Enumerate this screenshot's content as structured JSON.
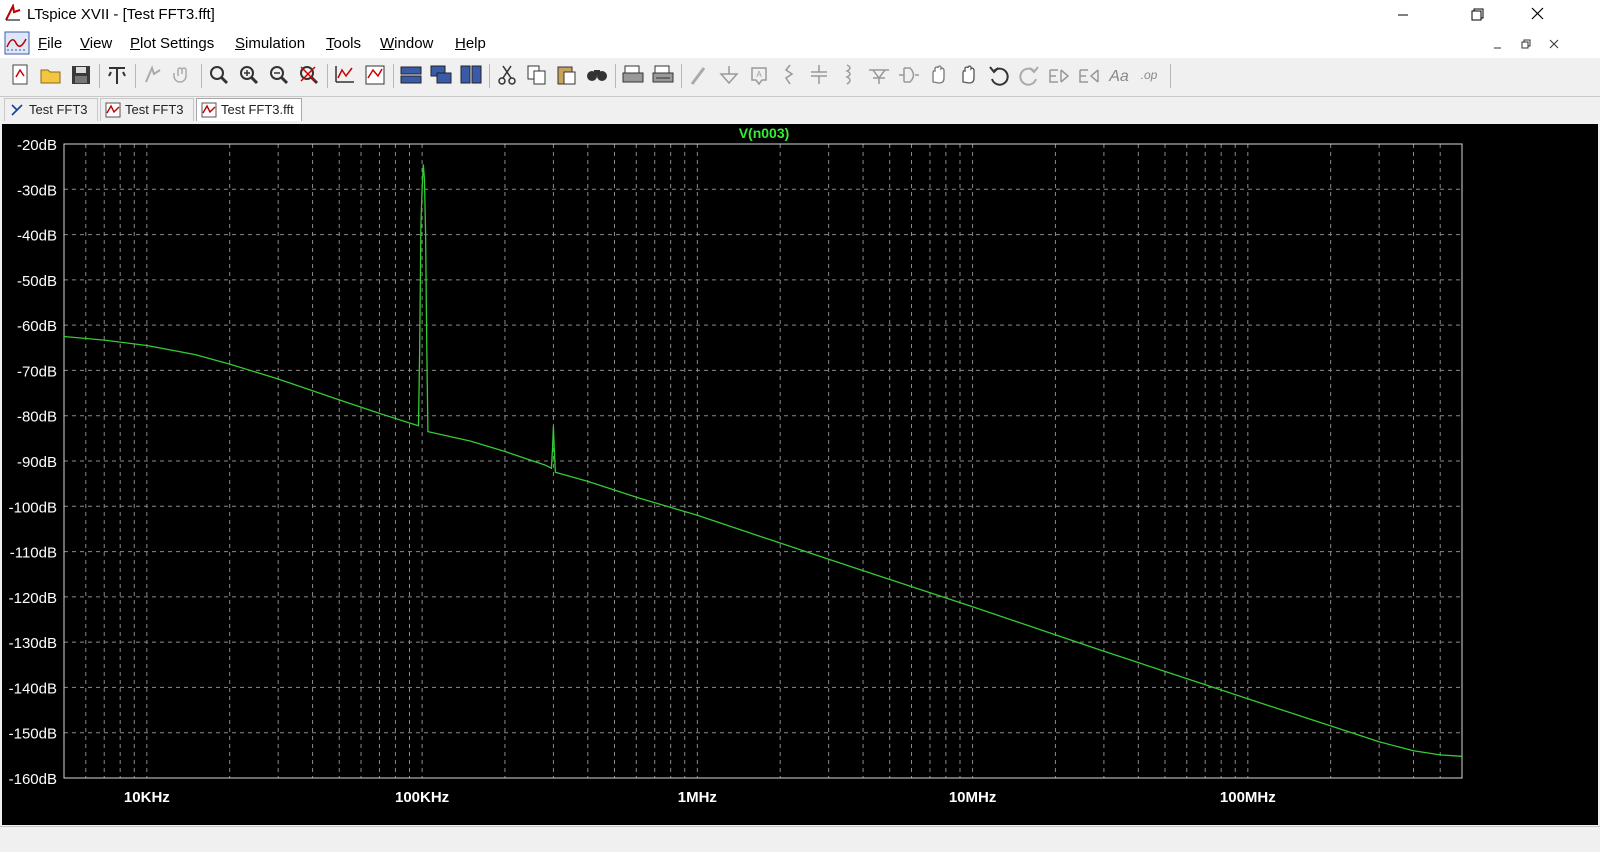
{
  "window": {
    "title": "LTspice XVII - [Test FFT3.fft]"
  },
  "menu": [
    {
      "label": "File"
    },
    {
      "label": "View"
    },
    {
      "label": "Plot Settings"
    },
    {
      "label": "Simulation"
    },
    {
      "label": "Tools"
    },
    {
      "label": "Window"
    },
    {
      "label": "Help"
    }
  ],
  "tabs": [
    {
      "label": "Test FFT3",
      "icon": "schematic-icon",
      "active": false
    },
    {
      "label": "Test FFT3",
      "icon": "waveform-icon",
      "active": false
    },
    {
      "label": "Test FFT3.fft",
      "icon": "fft-icon",
      "active": true
    }
  ],
  "toolbar": {
    "buttons": [
      "new-schematic",
      "open",
      "save",
      "control-panel",
      "run",
      "halt",
      "zoom-area",
      "zoom-in",
      "zoom-out",
      "zoom-fit",
      "autoscale",
      "delete-traces",
      "tile-horizontal",
      "cascade",
      "tile-vertical",
      "cut",
      "copy",
      "paste",
      "find",
      "print",
      "print-preview",
      "draw-wire",
      "ground",
      "label-net",
      "resistor",
      "capacitor",
      "inductor",
      "diode",
      "component",
      "move",
      "drag",
      "undo",
      "redo",
      "rotate",
      "mirror",
      "text",
      "spice-directive"
    ]
  },
  "colors": {
    "trace": "#33cc33",
    "grid": "#8a8a8a",
    "axis_text": "#ffffff",
    "background": "#000000",
    "title": "#33ee33"
  },
  "chart_data": {
    "type": "line",
    "title": "V(n003)",
    "xscale": "log",
    "xlim": [
      5000,
      600000000
    ],
    "ylim": [
      -160,
      -20
    ],
    "xticks": [
      {
        "value": 10000,
        "label": "10KHz"
      },
      {
        "value": 100000,
        "label": "100KHz"
      },
      {
        "value": 1000000,
        "label": "1MHz"
      },
      {
        "value": 10000000,
        "label": "10MHz"
      },
      {
        "value": 100000000,
        "label": "100MHz"
      }
    ],
    "yticks": [
      {
        "value": -20,
        "label": "-20dB"
      },
      {
        "value": -30,
        "label": "-30dB"
      },
      {
        "value": -40,
        "label": "-40dB"
      },
      {
        "value": -50,
        "label": "-50dB"
      },
      {
        "value": -60,
        "label": "-60dB"
      },
      {
        "value": -70,
        "label": "-70dB"
      },
      {
        "value": -80,
        "label": "-80dB"
      },
      {
        "value": -90,
        "label": "-90dB"
      },
      {
        "value": -100,
        "label": "-100dB"
      },
      {
        "value": -110,
        "label": "-110dB"
      },
      {
        "value": -120,
        "label": "-120dB"
      },
      {
        "value": -130,
        "label": "-130dB"
      },
      {
        "value": -140,
        "label": "-140dB"
      },
      {
        "value": -150,
        "label": "-150dB"
      },
      {
        "value": -160,
        "label": "-160dB"
      }
    ],
    "grid": true,
    "series": [
      {
        "name": "V(n003)",
        "points": [
          [
            5000,
            -62.5
          ],
          [
            7000,
            -63.3
          ],
          [
            10000,
            -64.5
          ],
          [
            15000,
            -66.5
          ],
          [
            20000,
            -68.6
          ],
          [
            30000,
            -71.9
          ],
          [
            50000,
            -76.5
          ],
          [
            70000,
            -79.5
          ],
          [
            90000,
            -81.6
          ],
          [
            97000,
            -82.2
          ],
          [
            98000,
            -65
          ],
          [
            99000,
            -38
          ],
          [
            100000,
            -30
          ],
          [
            101000,
            -24.5
          ],
          [
            102000,
            -28
          ],
          [
            103000,
            -40
          ],
          [
            104000,
            -65
          ],
          [
            105000,
            -83.5
          ],
          [
            150000,
            -85.6
          ],
          [
            200000,
            -87.9
          ],
          [
            280000,
            -90.9
          ],
          [
            295000,
            -91.6
          ],
          [
            298000,
            -87
          ],
          [
            300000,
            -82.3
          ],
          [
            302000,
            -87
          ],
          [
            305000,
            -92.5
          ],
          [
            400000,
            -94.5
          ],
          [
            600000,
            -98.0
          ],
          [
            1000000,
            -102.0
          ],
          [
            3000000,
            -111.7
          ],
          [
            10000000,
            -122.2
          ],
          [
            30000000,
            -132.0
          ],
          [
            100000000,
            -142.5
          ],
          [
            200000000,
            -148.5
          ],
          [
            300000000,
            -152.0
          ],
          [
            400000000,
            -154.0
          ],
          [
            500000000,
            -154.9
          ],
          [
            600000000,
            -155.2
          ]
        ]
      }
    ]
  }
}
